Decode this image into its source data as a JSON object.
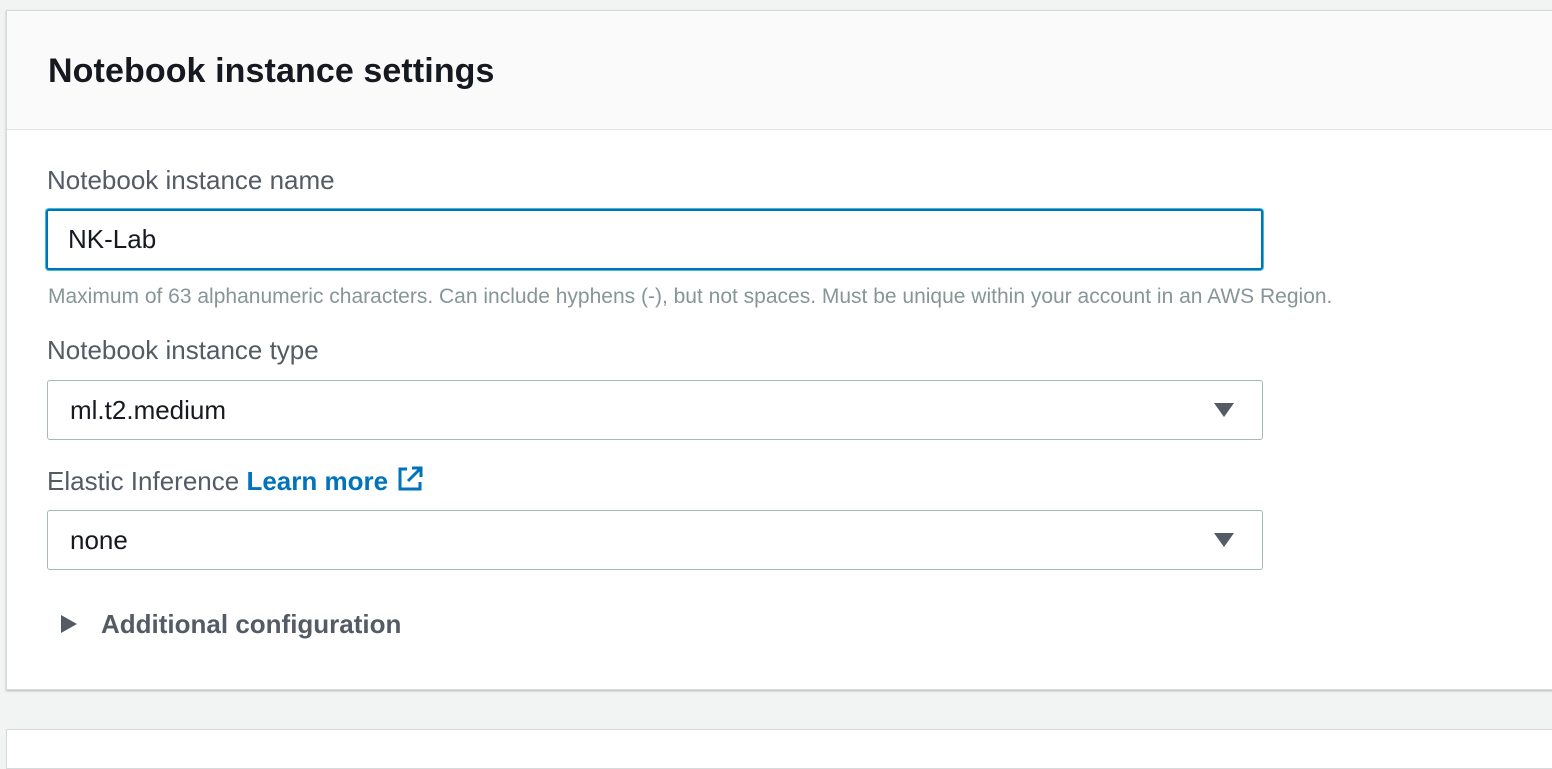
{
  "panel": {
    "title": "Notebook instance settings"
  },
  "name_field": {
    "label": "Notebook instance name",
    "value": "NK-Lab",
    "hint": "Maximum of 63 alphanumeric characters. Can include hyphens (-), but not spaces. Must be unique within your account in an AWS Region."
  },
  "type_field": {
    "label": "Notebook instance type",
    "value": "ml.t2.medium"
  },
  "elastic_field": {
    "label": "Elastic Inference",
    "link": "Learn more",
    "value": "none"
  },
  "additional": {
    "label": "Additional configuration"
  },
  "icons": {
    "caret": "caret-down-icon",
    "external": "external-link-icon",
    "expand": "caret-right-icon"
  },
  "colors": {
    "accent": "#0073bb",
    "focus_ring": "#44b9d6",
    "label": "#545b64",
    "hint": "#879596"
  }
}
